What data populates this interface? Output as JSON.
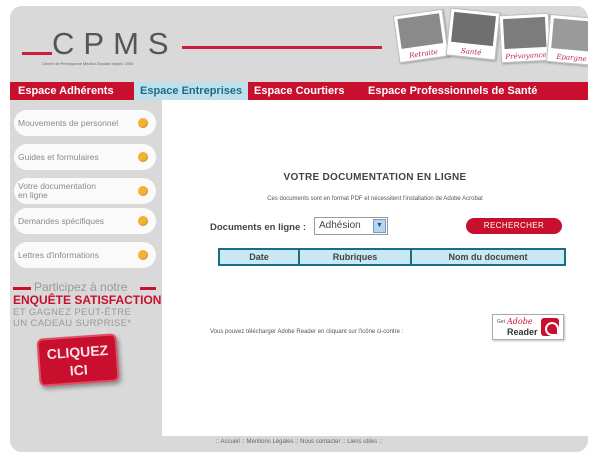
{
  "header": {
    "logo_text": "CPMS",
    "logo_subtitle": "Centre de Prévoyance Médico-Sociale depuis 1950",
    "photos": [
      "Retraite",
      "Santé",
      "Prévoyance",
      "Epargne"
    ]
  },
  "nav": {
    "tabs": [
      "Espace Adhérents",
      "Espace Entreprises",
      "Espace Courtiers",
      "Espace Professionnels de Santé"
    ],
    "active_tab": "Espace Entreprises"
  },
  "sidebar": {
    "items": [
      "Mouvements de personnel",
      "Guides et formulaires",
      "Votre documentation en ligne",
      "Demandes spécifiques",
      "Lettres d'informations"
    ]
  },
  "promo": {
    "line1": "Participez à notre",
    "line2": "ENQUÊTE SATISFACTION",
    "line3": "ET GAGNEZ PEUT-ÊTRE",
    "line4": "UN CADEAU SURPRISE*",
    "button_line1": "CLIQUEZ",
    "button_line2": "ICI"
  },
  "main": {
    "title": "VOTRE DOCUMENTATION EN LIGNE",
    "note": "Ces documents sont en format PDF et nécessitent l'installation de Adobe Acrobat",
    "online_label": "Documents en ligne :",
    "select_value": "Adhésion",
    "search_button": "RECHERCHER",
    "table_headers": [
      "Date",
      "Rubriques",
      "Nom du document"
    ],
    "reader_text": "Vous pouvez télécharger Adobe Reader en cliquant sur l'icône ci-contre :",
    "reader_badge": {
      "get": "Get",
      "adobe": "Adobe",
      "reader": "Reader"
    }
  },
  "footer": {
    "links": [
      "Accueil",
      "Mentions Légales",
      "Nous contacter",
      "Liens utiles"
    ]
  },
  "colors": {
    "brand_red": "#c8102e",
    "active_tab_bg": "#bfe0ea",
    "table_header_bg": "#c8e8f3",
    "table_border": "#1b6d86",
    "sidebar_dot": "#f2b233"
  }
}
